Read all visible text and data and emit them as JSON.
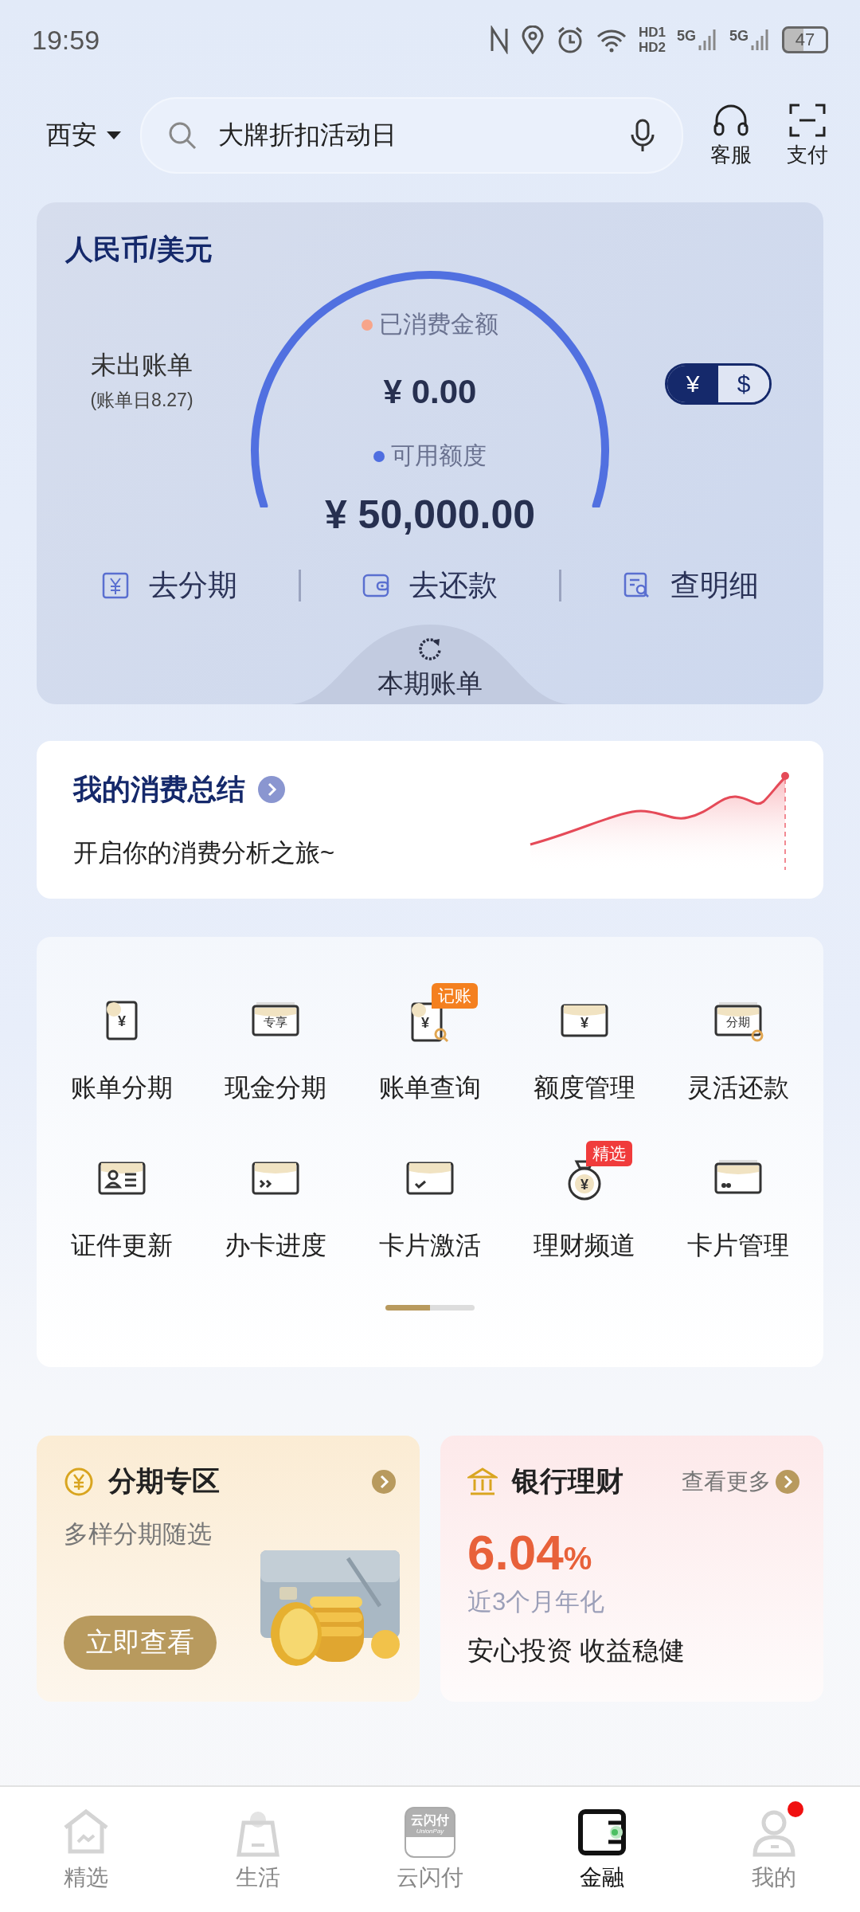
{
  "status_bar": {
    "time": "19:59",
    "hd": [
      "HD1",
      "HD2"
    ],
    "networks": [
      "5G",
      "5G"
    ],
    "battery": "47"
  },
  "header": {
    "city": "西安",
    "search": {
      "placeholder": "大牌折扣活动日"
    },
    "actions": [
      {
        "kind": "service",
        "label": "客服"
      },
      {
        "kind": "pay",
        "label": "支付"
      }
    ]
  },
  "bill_card": {
    "title": "人民币/美元",
    "status": "未出账单",
    "bill_date": "(账单日8.27)",
    "spent_label": "已消费金额",
    "spent": "¥ 0.00",
    "available_label": "可用额度",
    "available": "¥ 50,000.00",
    "currencies": [
      {
        "symbol": "¥",
        "selected": true
      },
      {
        "symbol": "$",
        "selected": false
      }
    ],
    "actions": [
      {
        "kind": "installment",
        "label": "去分期"
      },
      {
        "kind": "repay",
        "label": "去还款"
      },
      {
        "kind": "detail",
        "label": "查明细"
      }
    ],
    "current_bill": "本期账单"
  },
  "summary": {
    "title": "我的消费总结",
    "subtitle": "开启你的消费分析之旅~"
  },
  "services": {
    "items": [
      {
        "kind": "yen-doc",
        "label": "账单分期",
        "icon_text": "¥"
      },
      {
        "kind": "exclusive",
        "label": "现金分期",
        "icon_text": "专享"
      },
      {
        "kind": "bill-search",
        "label": "账单查询",
        "icon_text": "¥",
        "badge": "记账",
        "color": "#f4801f"
      },
      {
        "kind": "yen-card",
        "label": "额度管理",
        "icon_text": "¥"
      },
      {
        "kind": "installment-card",
        "label": "灵活还款",
        "icon_text": "分期"
      },
      {
        "kind": "id-card",
        "label": "证件更新"
      },
      {
        "kind": "progress-card",
        "label": "办卡进度"
      },
      {
        "kind": "check-card",
        "label": "卡片激活"
      },
      {
        "kind": "money-bag",
        "label": "理财频道",
        "icon_text": "¥",
        "badge": "精选",
        "color": "#f03c3c"
      },
      {
        "kind": "cards",
        "label": "卡片管理"
      }
    ],
    "pages": [
      {
        "selected": true
      },
      {
        "selected": false
      }
    ]
  },
  "promos": [
    {
      "kind": "installment",
      "title": "分期专区",
      "subtitle": "多样分期随选",
      "button": "立即查看"
    },
    {
      "kind": "wealth",
      "title": "银行理财",
      "more": "查看更多",
      "rate": "6.04",
      "rate_unit": "%",
      "rate_label": "近3个月年化",
      "slogan": "安心投资 收益稳健"
    }
  ],
  "tab_bar": [
    {
      "kind": "home",
      "label": "精选",
      "selected": false,
      "notification": false
    },
    {
      "kind": "bag",
      "label": "生活",
      "selected": false,
      "notification": false
    },
    {
      "kind": "unionpay",
      "label": "云闪付",
      "selected": false,
      "notification": false,
      "logo_text": "云闪付",
      "logo_sub": "UnionPay"
    },
    {
      "kind": "wallet",
      "label": "金融",
      "selected": true,
      "notification": false
    },
    {
      "kind": "person",
      "label": "我的",
      "selected": false,
      "notification": true
    }
  ]
}
